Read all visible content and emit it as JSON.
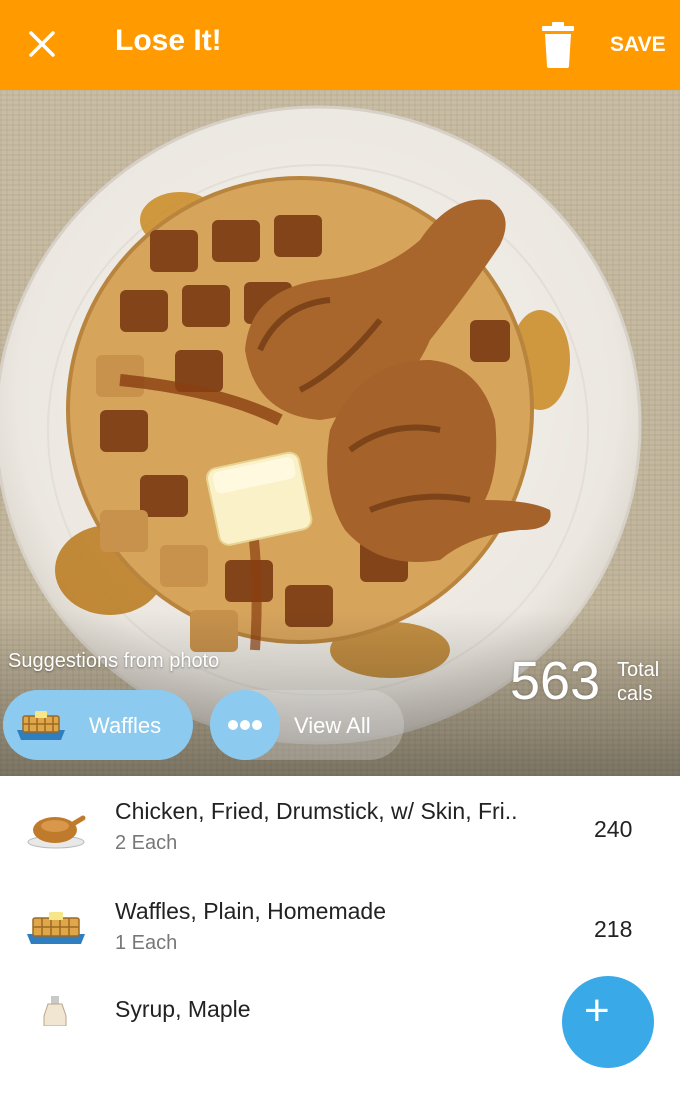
{
  "appbar": {
    "title": "Lose It!",
    "save_label": "SAVE"
  },
  "calories": {
    "total": "563",
    "label_top": "Total",
    "label_bottom": "cals"
  },
  "suggestions": {
    "heading": "Suggestions from photo",
    "chips": [
      {
        "label": "Waffles",
        "icon": "waffle-icon"
      }
    ],
    "view_all_label": "View All"
  },
  "foods": [
    {
      "name": "Chicken, Fried, Drumstick, w/ Skin, Fri..",
      "quantity": "2 Each",
      "calories": "240",
      "icon": "fried-chicken-icon"
    },
    {
      "name": "Waffles, Plain, Homemade",
      "quantity": "1 Each",
      "calories": "218",
      "icon": "waffle-icon"
    },
    {
      "name": "Syrup, Maple",
      "quantity": "",
      "calories": "",
      "icon": "syrup-bottle-icon"
    }
  ],
  "colors": {
    "appbar": "#ff9a00",
    "chip": "#8ccbef",
    "fab": "#3aa9e8"
  }
}
